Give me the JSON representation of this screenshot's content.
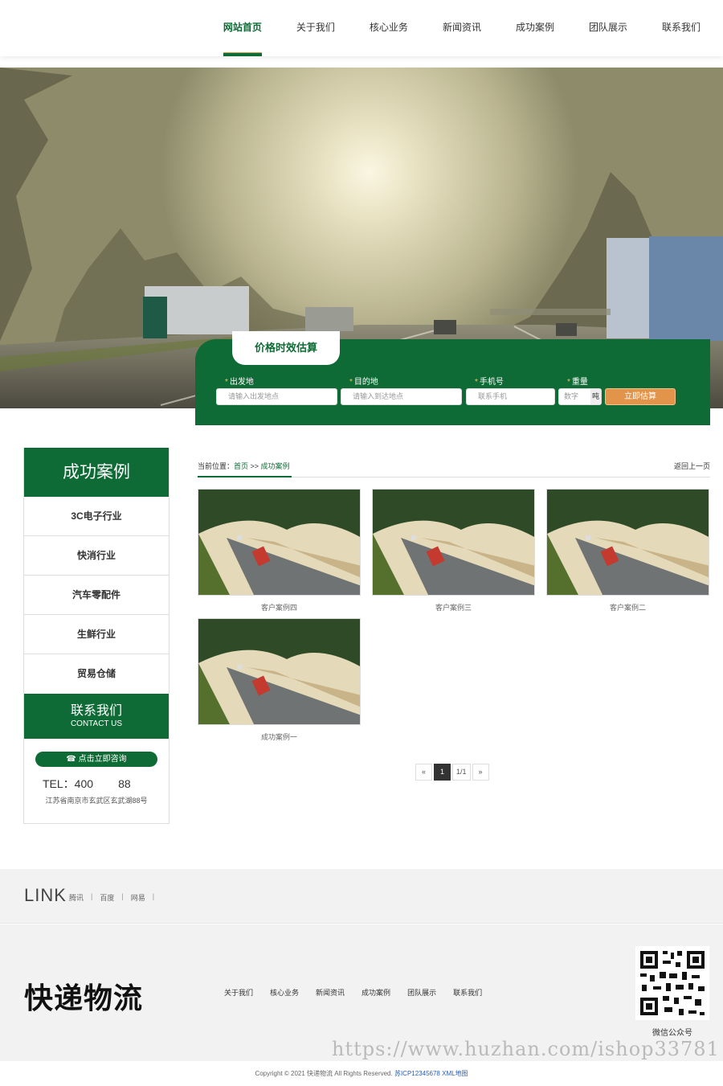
{
  "nav": {
    "items": [
      "网站首页",
      "关于我们",
      "核心业务",
      "新闻资讯",
      "成功案例",
      "团队展示",
      "联系我们"
    ],
    "active_index": 0
  },
  "estimate": {
    "title": "价格时效估算",
    "fields": [
      {
        "label": "出发地",
        "placeholder": "请输入出发地点"
      },
      {
        "label": "目的地",
        "placeholder": "请输入到达地点"
      },
      {
        "label": "手机号",
        "placeholder": "联系手机"
      },
      {
        "label": "重量",
        "placeholder": "数字",
        "unit": "吨"
      }
    ],
    "required_mark": "*",
    "submit": "立即估算"
  },
  "sidebar": {
    "title": "成功案例",
    "items": [
      "3C电子行业",
      "快消行业",
      "汽车零配件",
      "生鲜行业",
      "贸易仓储"
    ],
    "contact_title": "联系我们",
    "contact_subtitle": "CONTACT US",
    "consult_button": "点击立即咨询",
    "tel": "TEL：400        88",
    "address": "江苏省南京市玄武区玄武湖88号"
  },
  "breadcrumb": {
    "prefix": "当前位置：",
    "home": "首页",
    "sep": " >> ",
    "current": "成功案例",
    "back": "返回上一页"
  },
  "cases": [
    "客户案例四",
    "客户案例三",
    "客户案例二",
    "成功案例一"
  ],
  "pagination": {
    "prev": "«",
    "current": "1",
    "info": "1/1",
    "next": "»"
  },
  "links": {
    "title": "LINK",
    "items": [
      "腾讯",
      "百度",
      "网易"
    ],
    "sep": "|"
  },
  "footer": {
    "logo": "快递物流",
    "nav": [
      "关于我们",
      "核心业务",
      "新闻资讯",
      "成功案例",
      "团队展示",
      "联系我们"
    ],
    "qr_label": "微信公众号",
    "watermark": "https://www.huzhan.com/ishop33781"
  },
  "copyright": {
    "text": "Copyright © 2021 快递物流 All Rights Reserved. ",
    "icp": "苏ICP12345678",
    "xml": " XML地图"
  },
  "colors": {
    "brand_green": "#0e6b35",
    "accent_orange": "#e2944a"
  },
  "icons": {
    "phone": "phone-icon",
    "prev": "chevron-double-left-icon",
    "next": "chevron-double-right-icon"
  }
}
